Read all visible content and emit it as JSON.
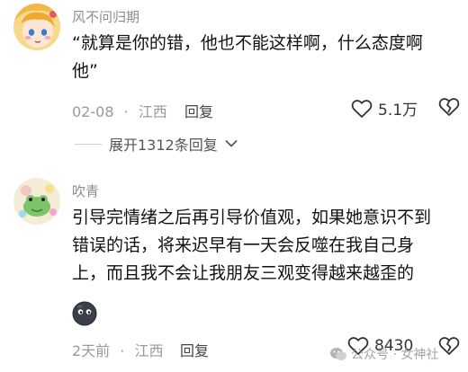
{
  "comments": [
    {
      "username": "风不问归期",
      "text_lines": [
        "“就算是你的错，他也不能这样啊，什么态度啊",
        "他”"
      ],
      "date": "02-08",
      "sep": "·",
      "location": "江西",
      "reply_label": "回复",
      "likes": "5.1万",
      "avatar_icon": "anime-girl-avatar"
    },
    {
      "username": "吹青",
      "text_lines": [
        "引导完情绪之后再引导价值观，如果她意识不到",
        "错误的话，将来迟早有一天会反噬在我自己身",
        "上，而且我不会让我朋友三观变得越来越歪的"
      ],
      "date": "2天前",
      "sep": "·",
      "location": "江西",
      "reply_label": "回复",
      "likes": "8430",
      "avatar_icon": "cartoon-frog-avatar",
      "emoji_icon": "dark-blob-emoji"
    }
  ],
  "expand_replies": "展开1312条回复",
  "watermark": "公众号 · 女神社"
}
